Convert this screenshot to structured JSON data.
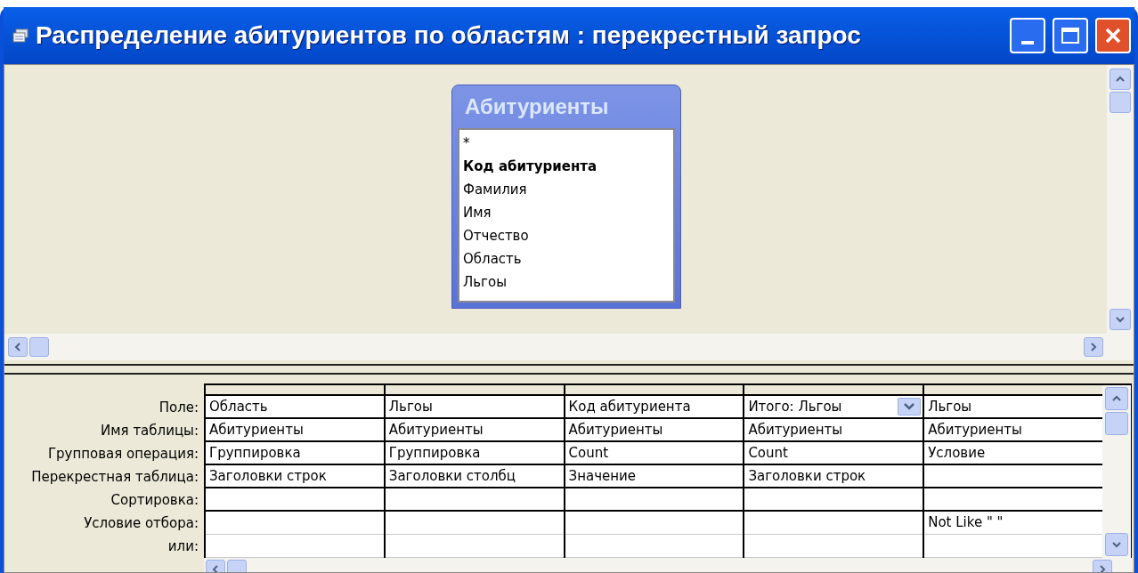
{
  "window": {
    "title": "Распределение абитуриентов по областям : перекрестный запрос"
  },
  "table_box": {
    "title": "Абитуриенты",
    "fields": [
      {
        "name": "*",
        "primary_key": false
      },
      {
        "name": "Код абитуриента",
        "primary_key": true
      },
      {
        "name": "Фамилия",
        "primary_key": false
      },
      {
        "name": "Имя",
        "primary_key": false
      },
      {
        "name": "Отчество",
        "primary_key": false
      },
      {
        "name": "Область",
        "primary_key": false
      },
      {
        "name": "Льгоы",
        "primary_key": false
      }
    ]
  },
  "grid": {
    "row_labels": [
      "Поле:",
      "Имя таблицы:",
      "Групповая операция:",
      "Перекрестная таблица:",
      "Сортировка:",
      "Условие отбора:",
      "или:"
    ],
    "columns": [
      {
        "dropdown": false,
        "cells": [
          "Область",
          "Абитуриенты",
          "Группировка",
          "Заголовки строк",
          "",
          "",
          ""
        ]
      },
      {
        "dropdown": false,
        "cells": [
          "Льгоы",
          "Абитуриенты",
          "Группировка",
          "Заголовки столбц",
          "",
          "",
          ""
        ]
      },
      {
        "dropdown": false,
        "cells": [
          "Код абитуриента",
          "Абитуриенты",
          "Count",
          "Значение",
          "",
          "",
          ""
        ]
      },
      {
        "dropdown": true,
        "cells": [
          "Итого: Льгоы",
          "Абитуриенты",
          "Count",
          "Заголовки строк",
          "",
          "",
          ""
        ]
      },
      {
        "dropdown": false,
        "cells": [
          "Льгоы",
          "Абитуриенты",
          "Условие",
          "",
          "",
          "Not Like \" \"",
          ""
        ]
      }
    ]
  }
}
